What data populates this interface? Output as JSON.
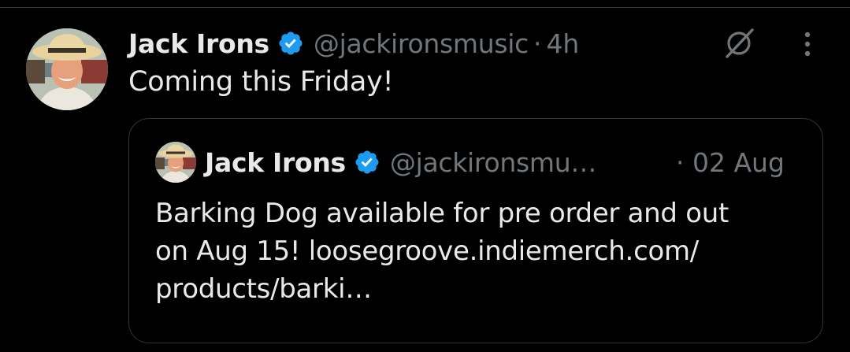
{
  "tweet": {
    "author": {
      "name": "Jack Irons",
      "handle": "@jackironsmusic",
      "verified": true,
      "avatar": "avatar-photo"
    },
    "separator": "·",
    "time": "4h",
    "text": "Coming this Friday!",
    "icons": {
      "grok": "grok-icon",
      "more": "more-vertical-icon"
    },
    "quoted": {
      "author": {
        "name": "Jack Irons",
        "handle": "@jackironsmu…",
        "verified": true,
        "avatar": "avatar-photo"
      },
      "time": "· 02 Aug",
      "text_lines": [
        "Barking Dog available for pre order and out",
        "on Aug 15! loosegroove.indiemerch.com/",
        "products/barki…"
      ]
    }
  },
  "colors": {
    "background": "#000000",
    "text_primary": "#e7e9ea",
    "text_secondary": "#71767b",
    "border": "#2f3336",
    "verified_blue": "#1d9bf0"
  }
}
